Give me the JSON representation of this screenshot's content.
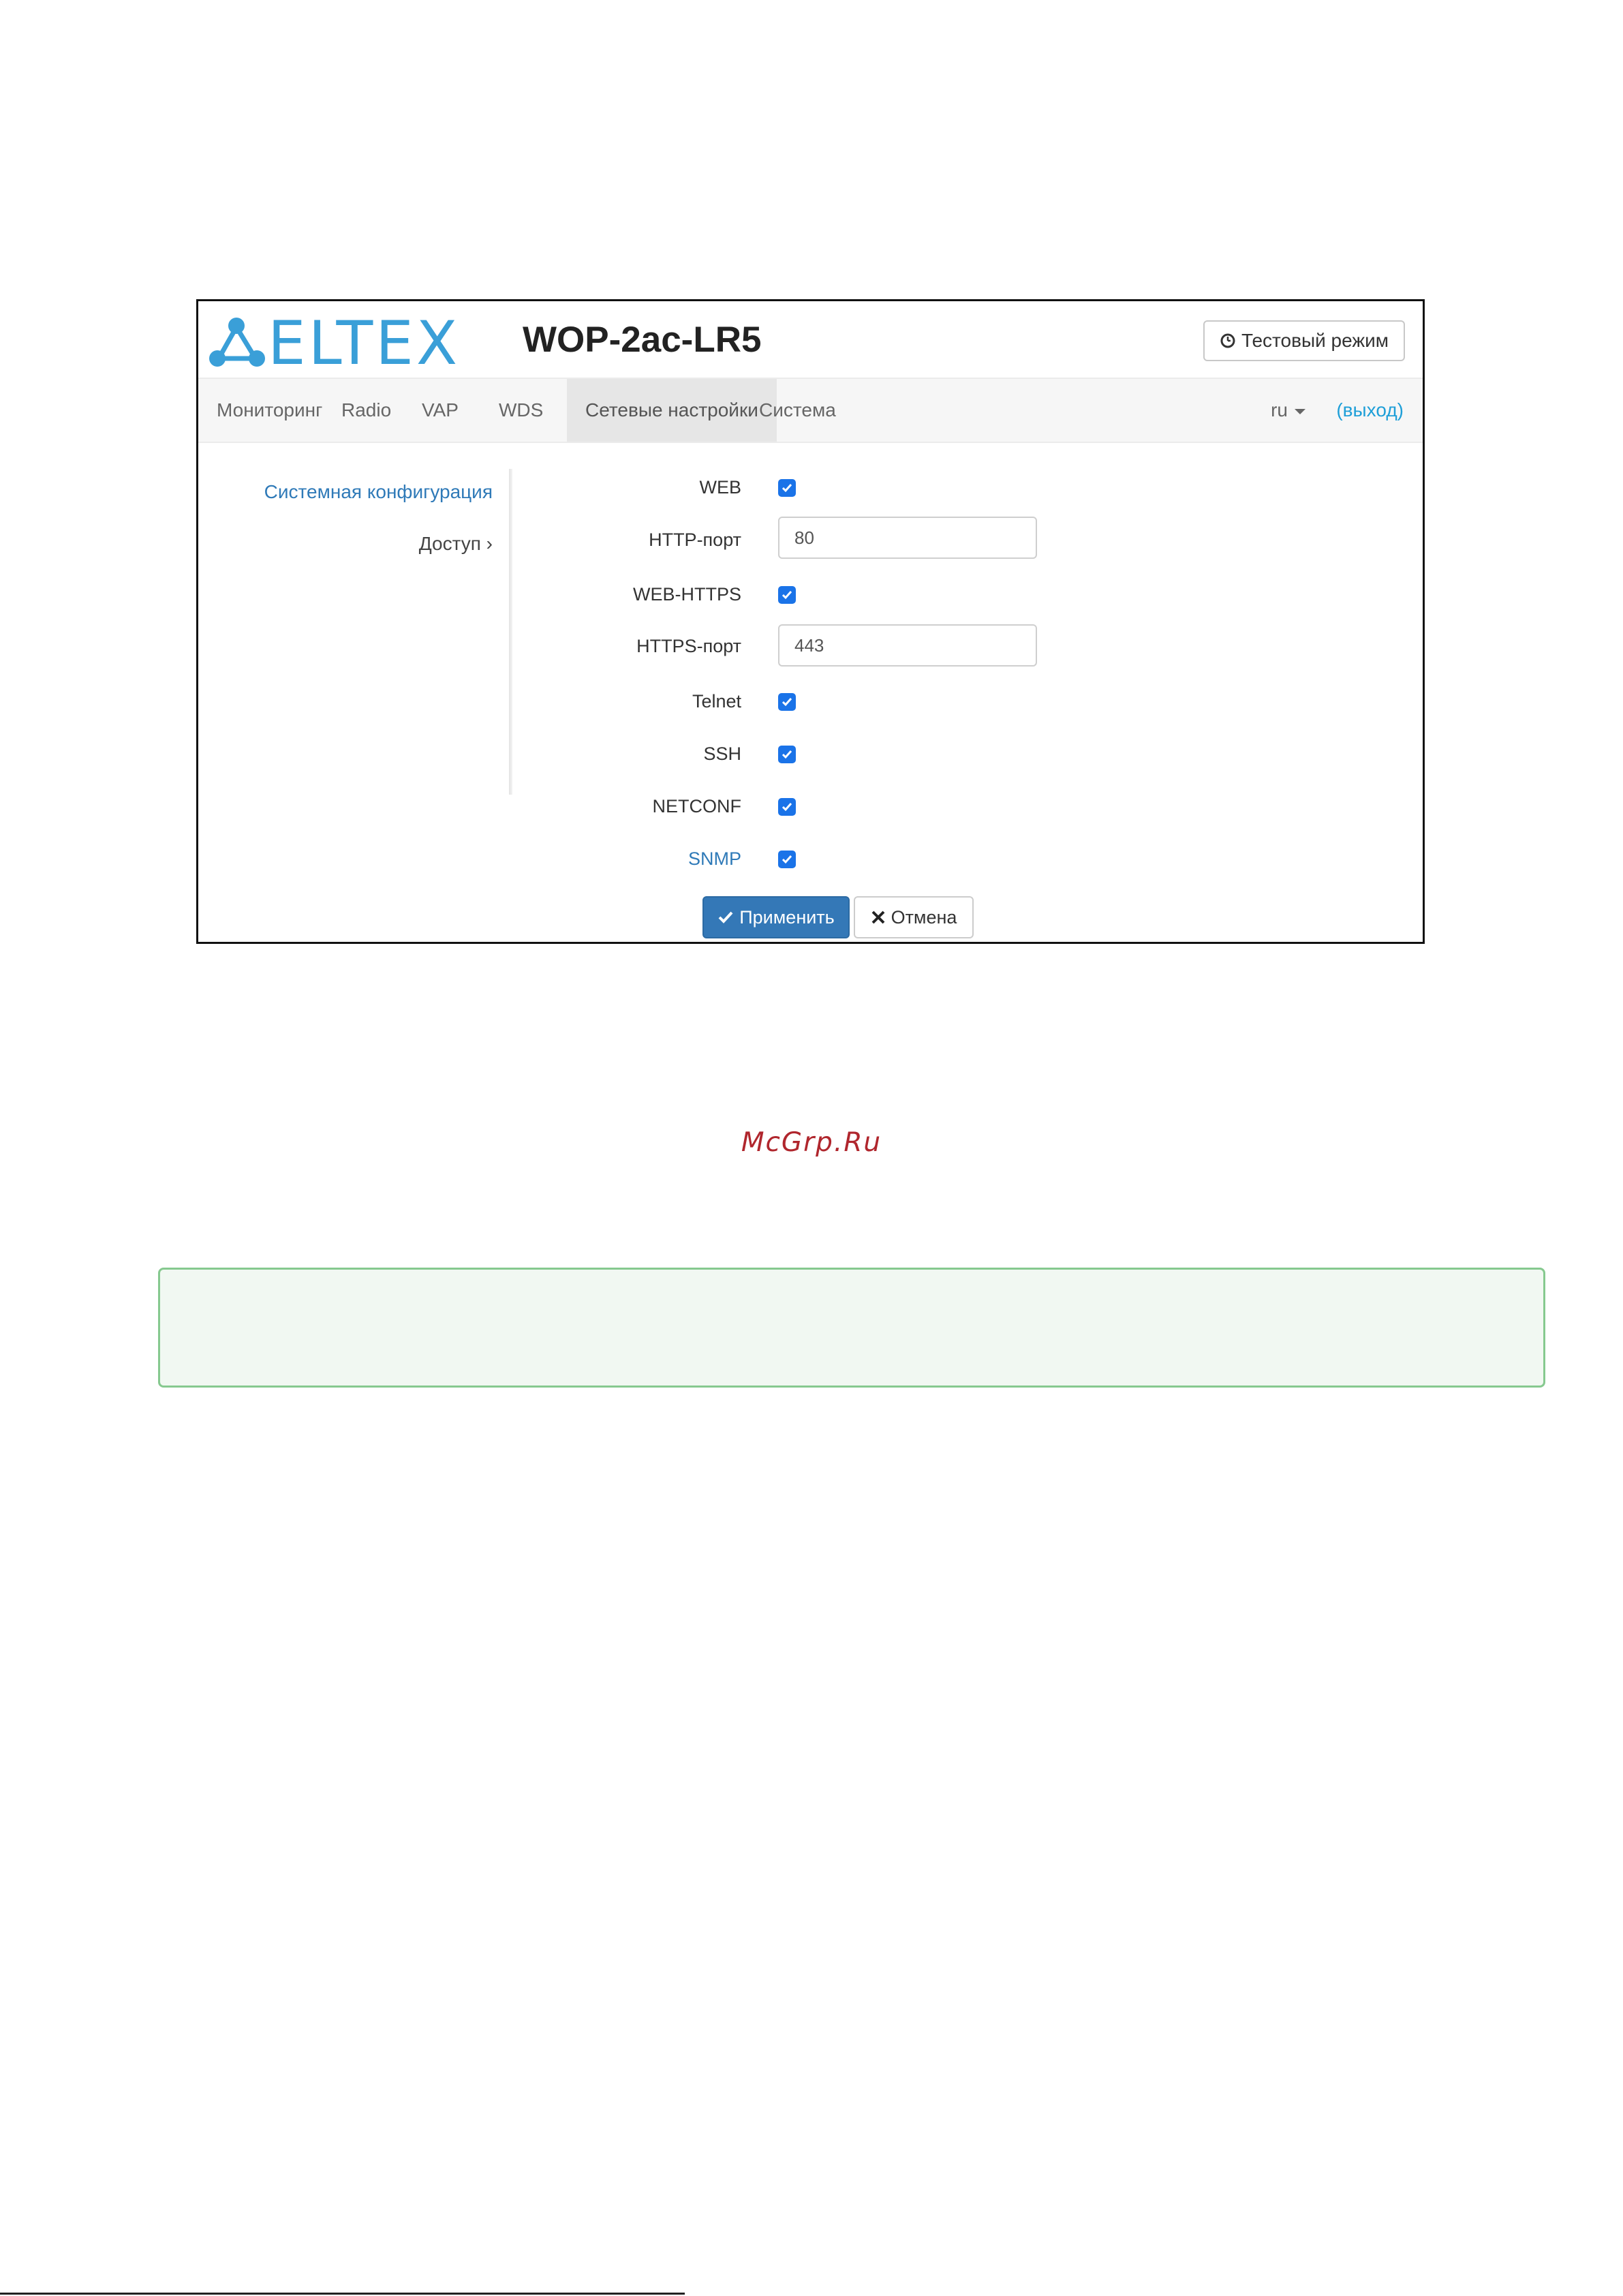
{
  "header": {
    "logo_text": "ELTEX",
    "device_title": "WOP-2ac-LR5",
    "test_mode_label": "Тестовый режим"
  },
  "navbar": {
    "items": [
      {
        "label": "Мониторинг",
        "active": false
      },
      {
        "label": "Radio",
        "active": false
      },
      {
        "label": "VAP",
        "active": false
      },
      {
        "label": "WDS",
        "active": false
      },
      {
        "label": "Сетевые настройки",
        "active": true
      },
      {
        "label": "Система",
        "active": false
      }
    ],
    "language": "ru",
    "logout": "(выход)"
  },
  "sidebar": {
    "items": [
      {
        "label": "Системная конфигурация"
      },
      {
        "label": "Доступ",
        "suffix": "›"
      }
    ]
  },
  "form": {
    "web_label": "WEB",
    "web_checked": true,
    "http_port_label": "HTTP-порт",
    "http_port_value": "80",
    "web_https_label": "WEB-HTTPS",
    "web_https_checked": true,
    "https_port_label": "HTTPS-порт",
    "https_port_value": "443",
    "telnet_label": "Telnet",
    "telnet_checked": true,
    "ssh_label": "SSH",
    "ssh_checked": true,
    "netconf_label": "NETCONF",
    "netconf_checked": true,
    "snmp_label": "SNMP",
    "snmp_checked": true,
    "apply_label": "Применить",
    "cancel_label": "Отмена"
  },
  "watermark": "McGrp.Ru",
  "colors": {
    "brand_blue": "#3a9fd8",
    "primary_button": "#3478b7",
    "checkbox_blue": "#1a73e8",
    "link_blue": "#2f7ab8",
    "note_border": "#86c98f",
    "watermark_red": "#b0262d"
  },
  "icons": {
    "test_mode": "clock-icon",
    "apply": "check-icon",
    "cancel": "x-icon",
    "language_dropdown": "caret-down-icon"
  }
}
